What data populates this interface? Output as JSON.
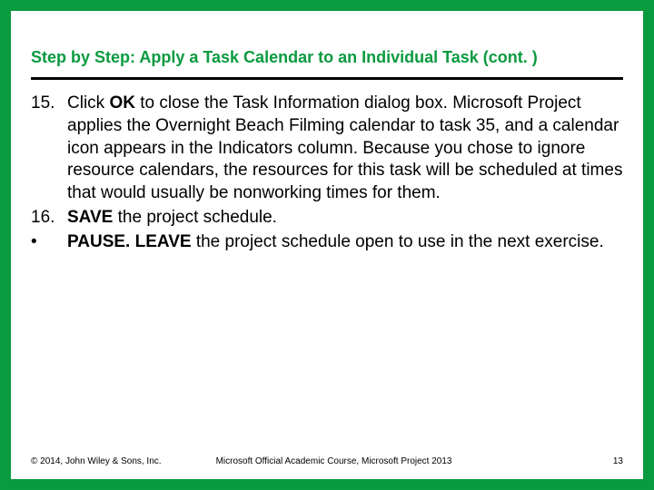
{
  "title": "Step by Step: Apply a Task Calendar to an Individual Task (cont. )",
  "items": {
    "n15": "15.",
    "t15a": "Click ",
    "t15b": "OK",
    "t15c": " to close the Task Information dialog box. Microsoft Project applies the Overnight Beach Filming calendar to task 35, and a calendar icon appears in the Indicators column. Because you chose to ignore resource calendars, the resources for this task will be scheduled at times that would usually be nonworking times for them.",
    "n16": "16.",
    "t16a": "SAVE",
    "t16b": " the project schedule.",
    "nB": "•",
    "tBa": "PAUSE. LEAVE",
    "tBb": " the project schedule open to use in the next exercise."
  },
  "footer": {
    "copyright": "© 2014, John Wiley & Sons, Inc.",
    "course": "Microsoft Official Academic Course, Microsoft Project 2013",
    "page": "13"
  }
}
